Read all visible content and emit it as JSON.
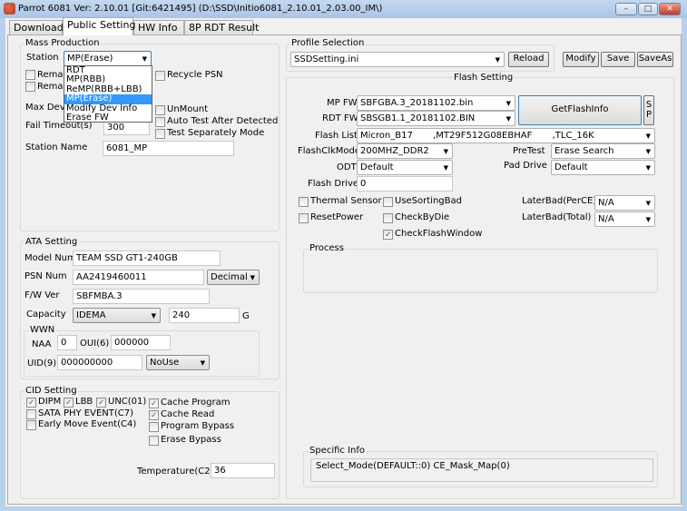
{
  "window": {
    "title": "Parrot 6081 Ver: 2.10.01 [Git:6421495] (D:\\SSD\\Initio6081_2.10.01_2.03.00_IM\\)",
    "minimize": "–",
    "maximize": "□",
    "close": "✕"
  },
  "tabs": [
    {
      "label": "Download"
    },
    {
      "label": "Public Setting",
      "active": true
    },
    {
      "label": "HW Info"
    },
    {
      "label": "8P RDT Result"
    }
  ],
  "mass_production": {
    "title": "Mass Production",
    "station_label": "Station",
    "station_value": "MP(Erase)",
    "station_options": [
      "RDT",
      "MP(RBB)",
      "ReMP(RBB+LBB)",
      "MP(Erase)",
      "Modify Dev Info",
      "Erase FW"
    ],
    "remain1": "Remai",
    "remain2": "Remai",
    "recycle_psn": "Recycle PSN",
    "max_dev_label": "Max Devi",
    "unmount": "UnMount",
    "fail_timeout_label": "Fail Timeout(s)",
    "fail_timeout_value": "300",
    "auto_test": "Auto Test After Detected",
    "test_separately": "Test Separately Mode",
    "station_name_label": "Station Name",
    "station_name_value": "6081_MP"
  },
  "ata": {
    "title": "ATA Setting",
    "model_label": "Model Num",
    "model_value": "TEAM SSD GT1-240GB",
    "psn_label": "PSN Num",
    "psn_value": "AA2419460011",
    "psn_format": "Decimal",
    "fw_label": "F/W Ver",
    "fw_value": "SBFMBA.3",
    "capacity_label": "Capacity",
    "capacity_mode": "IDEMA",
    "capacity_value": "240",
    "capacity_unit": "G",
    "wwn": {
      "title": "WWN",
      "naa_label": "NAA",
      "naa_value": "0",
      "oui_label": "OUI(6)",
      "oui_value": "000000",
      "uid_label": "UID(9)",
      "uid_value": "000000000",
      "uid_mode": "NoUse"
    }
  },
  "cid": {
    "title": "CID Setting",
    "dipm": "DIPM",
    "lbb": "LBB",
    "unc": "UNC(01)",
    "sata_phy": "SATA PHY EVENT(C7)",
    "early_move": "Early Move Event(C4)",
    "cache_program": "Cache Program",
    "cache_read": "Cache Read",
    "program_bypass": "Program Bypass",
    "erase_bypass": "Erase Bypass",
    "temp_label": "Temperature(C2)",
    "temp_value": "36",
    "check": "✓"
  },
  "profile": {
    "title": "Profile Selection",
    "value": "SSDSetting.ini",
    "reload": "Reload",
    "modify": "Modify",
    "save": "Save",
    "saveas": "SaveAs"
  },
  "flash": {
    "title": "Flash Setting",
    "mpfw_label": "MP FW",
    "mpfw_value": "SBFGBA.3_20181102.bin",
    "rdtfw_label": "RDT FW",
    "rdtfw_value": "SBSGB1.1_20181102.BIN",
    "get_flash_info": "GetFlashInfo",
    "sp": "S\nP",
    "flash_list_label": "Flash List",
    "flash_list_value": "Micron_B17       ,MT29F512G08EBHAF       ,TLC_16K",
    "clk_label": "FlashClkMode",
    "clk_value": "200MHZ_DDR2",
    "pretest_label": "PreTest",
    "pretest_value": "Erase Search",
    "odt_label": "ODT",
    "odt_value": "Default",
    "pad_label": "Pad Drive",
    "pad_value": "Default",
    "drive_label": "Flash Drive",
    "drive_value": "0",
    "thermal": "Thermal Sensor",
    "sorting": "UseSortingBad",
    "reset_power": "ResetPower",
    "check_by_die": "CheckByDie",
    "check_flash_window": "CheckFlashWindow",
    "laterbad_ce_label": "LaterBad(PerCE)",
    "laterbad_ce_value": "N/A",
    "laterbad_total_label": "LaterBad(Total)",
    "laterbad_total_value": "N/A"
  },
  "process": {
    "title": "Process"
  },
  "specific": {
    "title": "Specific Info",
    "text": "Select_Mode(DEFAULT::0) CE_Mask_Map(0)"
  },
  "arrow": "▼"
}
